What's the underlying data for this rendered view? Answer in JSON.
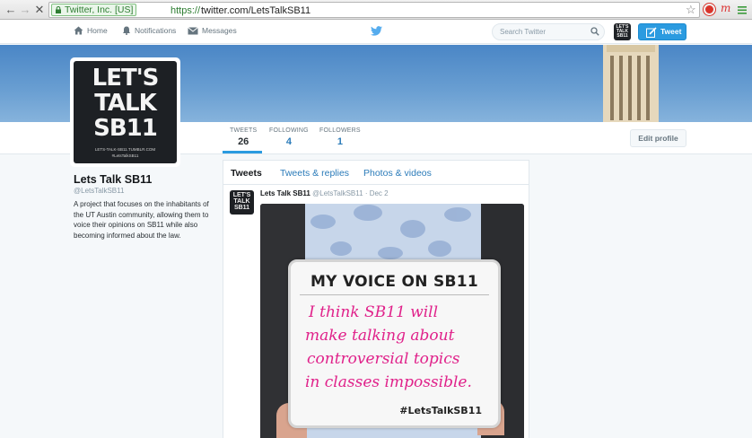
{
  "browser": {
    "ev_label": "Twitter, Inc. [US]",
    "url_scheme": "https://",
    "url_rest": "twitter.com/LetsTalkSB11"
  },
  "topnav": {
    "home": "Home",
    "notifications": "Notifications",
    "messages": "Messages",
    "search_placeholder": "Search Twitter",
    "tweet_button": "Tweet"
  },
  "avatar": {
    "line1": "LET'S",
    "line2": "TALK",
    "line3": "SB11",
    "url": "LETS-TALK-SB11.TUMBLR.COM",
    "hashtag": "#LetsTalkSB11"
  },
  "stats": [
    {
      "label": "TWEETS",
      "value": "26"
    },
    {
      "label": "FOLLOWING",
      "value": "4"
    },
    {
      "label": "FOLLOWERS",
      "value": "1"
    }
  ],
  "edit_profile": "Edit profile",
  "profile": {
    "name": "Lets Talk SB11",
    "handle": "@LetsTalkSB11",
    "bio": "A project that focuses on the inhabitants of the UT Austin community, allowing them to voice their opinions on SB11 while also becoming informed about the law."
  },
  "tabs": [
    "Tweets",
    "Tweets & replies",
    "Photos & videos"
  ],
  "tweet": {
    "name": "Lets Talk SB11",
    "handle": "@LetsTalkSB11",
    "date": "· Dec 2",
    "board_title": "MY VOICE ON SB11",
    "board_lines": [
      "I think SB11 will",
      "make talking about",
      "controversial topics",
      "in classes impossible."
    ],
    "board_hashtag": "#LetsTalkSB11"
  },
  "colors": {
    "brand": "#2b9be0",
    "link": "#2b7bb9",
    "ev_green": "#2e7d32",
    "marker_pink": "#e0218a"
  }
}
